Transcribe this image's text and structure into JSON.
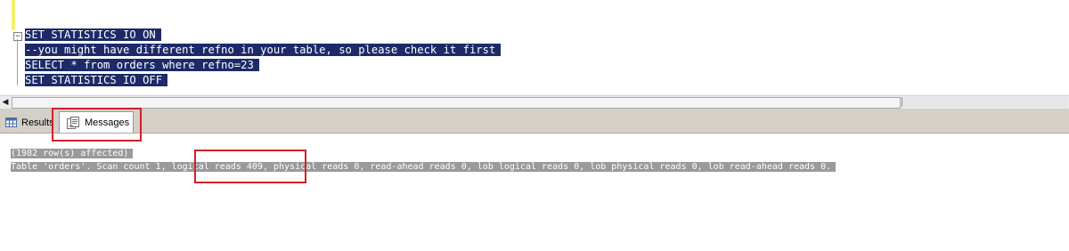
{
  "editor": {
    "collapse_glyph": "−",
    "lines": [
      "SET STATISTICS IO ON",
      "--you might have different refno in your table, so please check it first",
      "SELECT * from orders where refno=23",
      "SET STATISTICS IO OFF"
    ]
  },
  "scrollbar": {
    "left_arrow": "◀"
  },
  "tabs": {
    "results_label": "Results",
    "messages_label": "Messages"
  },
  "messages": {
    "lines": [
      "(1982 row(s) affected)",
      "Table 'orders'. Scan count 1, logical reads 409, physical reads 0, read-ahead reads 0, lob logical reads 0, lob physical reads 0, lob read-ahead reads 0."
    ]
  },
  "colors": {
    "selection": "#1c2a68",
    "message_highlight": "#9a9a9a",
    "annotation": "#d32027",
    "change_bar": "#f3f06a"
  },
  "icons": {
    "results": "grid-icon",
    "messages": "messages-icon"
  }
}
